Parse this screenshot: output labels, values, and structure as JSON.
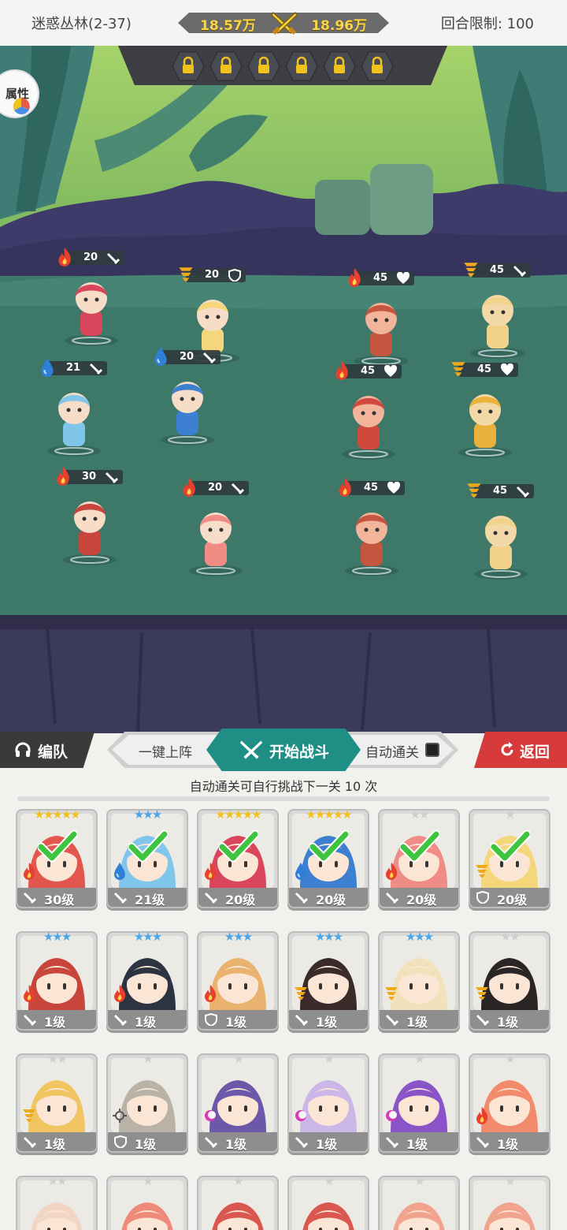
{
  "header": {
    "stage": "迷惑丛林(2-37)",
    "power_left": "18.57万",
    "power_right": "18.96万",
    "round_limit": "回合限制: 100"
  },
  "field": {
    "attr_button": "属性",
    "lock_slots": 6,
    "allies": [
      {
        "level": "20",
        "element": "fire",
        "role": "sword"
      },
      {
        "level": "20",
        "element": "wind",
        "role": "shield"
      },
      {
        "level": "21",
        "element": "water",
        "role": "sword"
      },
      {
        "level": "20",
        "element": "water",
        "role": "sword"
      },
      {
        "level": "30",
        "element": "fire",
        "role": "sword"
      },
      {
        "level": "20",
        "element": "fire",
        "role": "sword"
      }
    ],
    "enemies": [
      {
        "level": "45",
        "element": "fire",
        "role": "heart"
      },
      {
        "level": "45",
        "element": "wind",
        "role": "sword"
      },
      {
        "level": "45",
        "element": "fire",
        "role": "heart"
      },
      {
        "level": "45",
        "element": "wind",
        "role": "heart"
      },
      {
        "level": "45",
        "element": "fire",
        "role": "heart"
      },
      {
        "level": "45",
        "element": "wind",
        "role": "sword"
      }
    ]
  },
  "controls": {
    "team": "编队",
    "quick_deploy": "一键上阵",
    "start": "开始战斗",
    "auto_clear": "自动通关",
    "back": "返回",
    "hint": "自动通关可自行挑战下一关 10 次"
  },
  "heroes": [
    {
      "level": "30级",
      "stars": "★★★★★",
      "star_color": "gold",
      "element": "fire",
      "role": "sword",
      "selected": true,
      "hair": "#e2564d"
    },
    {
      "level": "21级",
      "stars": "★★★",
      "star_color": "blue",
      "element": "water",
      "role": "sword",
      "selected": true,
      "hair": "#7fc6ea"
    },
    {
      "level": "20级",
      "stars": "★★★★★",
      "star_color": "gold",
      "element": "fire",
      "role": "sword",
      "selected": true,
      "hair": "#d9455a"
    },
    {
      "level": "20级",
      "stars": "★★★★★",
      "star_color": "gold",
      "element": "water",
      "role": "sword",
      "selected": true,
      "hair": "#3d7fd0"
    },
    {
      "level": "20级",
      "stars": "★★",
      "star_color": "silver",
      "element": "fire",
      "role": "sword",
      "selected": true,
      "hair": "#ef8c86"
    },
    {
      "level": "20级",
      "stars": "★",
      "star_color": "silver",
      "element": "wind",
      "role": "shield",
      "selected": true,
      "hair": "#f3d77a"
    },
    {
      "level": "1级",
      "stars": "★★★",
      "star_color": "blue",
      "element": "fire",
      "role": "sword",
      "selected": false,
      "hair": "#c8453c"
    },
    {
      "level": "1级",
      "stars": "★★★",
      "star_color": "blue",
      "element": "fire",
      "role": "sword",
      "selected": false,
      "hair": "#2b3440"
    },
    {
      "level": "1级",
      "stars": "★★★",
      "star_color": "blue",
      "element": "fire",
      "role": "shield",
      "selected": false,
      "hair": "#e9b26e"
    },
    {
      "level": "1级",
      "stars": "★★★",
      "star_color": "blue",
      "element": "wind",
      "role": "sword",
      "selected": false,
      "hair": "#3a2a2a"
    },
    {
      "level": "1级",
      "stars": "★★★",
      "star_color": "blue",
      "element": "wind",
      "role": "sword",
      "selected": false,
      "hair": "#f1e2bc"
    },
    {
      "level": "1级",
      "stars": "★★",
      "star_color": "silver",
      "element": "wind",
      "role": "sword",
      "selected": false,
      "hair": "#2a2626"
    },
    {
      "level": "1级",
      "stars": "★★",
      "star_color": "silver",
      "element": "wind",
      "role": "sword",
      "selected": false,
      "hair": "#f0c461"
    },
    {
      "level": "1级",
      "stars": "★",
      "star_color": "silver",
      "element": "light",
      "role": "shield",
      "selected": false,
      "hair": "#b9b2a6"
    },
    {
      "level": "1级",
      "stars": "★",
      "star_color": "silver",
      "element": "dark",
      "role": "sword",
      "selected": false,
      "hair": "#6b58a8"
    },
    {
      "level": "1级",
      "stars": "★",
      "star_color": "silver",
      "element": "dark",
      "role": "sword",
      "selected": false,
      "hair": "#cbb6e8"
    },
    {
      "level": "1级",
      "stars": "★",
      "star_color": "silver",
      "element": "dark",
      "role": "sword",
      "selected": false,
      "hair": "#8a54c8"
    },
    {
      "level": "1级",
      "stars": "★",
      "star_color": "silver",
      "element": "fire",
      "role": "sword",
      "selected": false,
      "hair": "#f28a6c"
    },
    {
      "level": "",
      "stars": "★★",
      "star_color": "silver",
      "element": "",
      "role": "",
      "selected": false,
      "hair": "#f2d6c4"
    },
    {
      "level": "",
      "stars": "★",
      "star_color": "silver",
      "element": "",
      "role": "",
      "selected": false,
      "hair": "#ef8a7a"
    },
    {
      "level": "",
      "stars": "★",
      "star_color": "silver",
      "element": "",
      "role": "",
      "selected": false,
      "hair": "#d9574f"
    },
    {
      "level": "",
      "stars": "★",
      "star_color": "silver",
      "element": "",
      "role": "",
      "selected": false,
      "hair": "#d9574f"
    },
    {
      "level": "",
      "stars": "★",
      "star_color": "silver",
      "element": "",
      "role": "",
      "selected": false,
      "hair": "#f2a38e"
    },
    {
      "level": "",
      "stars": "★",
      "star_color": "silver",
      "element": "",
      "role": "",
      "selected": false,
      "hair": "#f2a38e"
    }
  ]
}
